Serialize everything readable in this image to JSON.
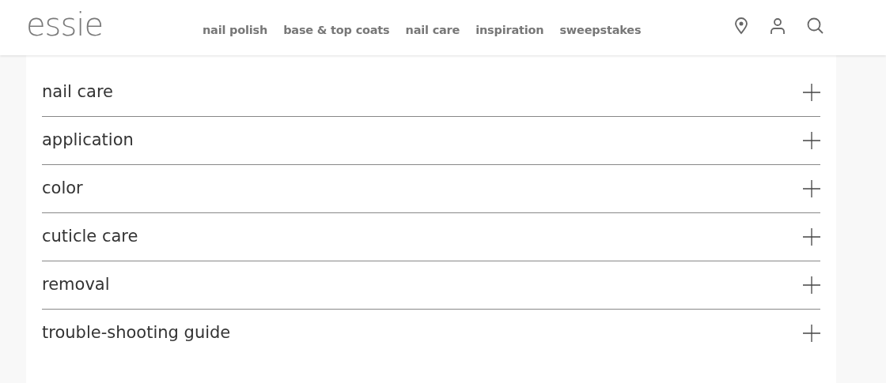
{
  "header": {
    "logo": "essie",
    "nav": [
      "nail polish",
      "base & top coats",
      "nail care",
      "inspiration",
      "sweepstakes"
    ]
  },
  "accordion": [
    {
      "title": "nail care",
      "expanded": false
    },
    {
      "title": "application",
      "expanded": false
    },
    {
      "title": "color",
      "expanded": false
    },
    {
      "title": "cuticle care",
      "expanded": false
    },
    {
      "title": "removal",
      "expanded": false
    },
    {
      "title": "trouble-shooting guide",
      "expanded": false
    }
  ]
}
